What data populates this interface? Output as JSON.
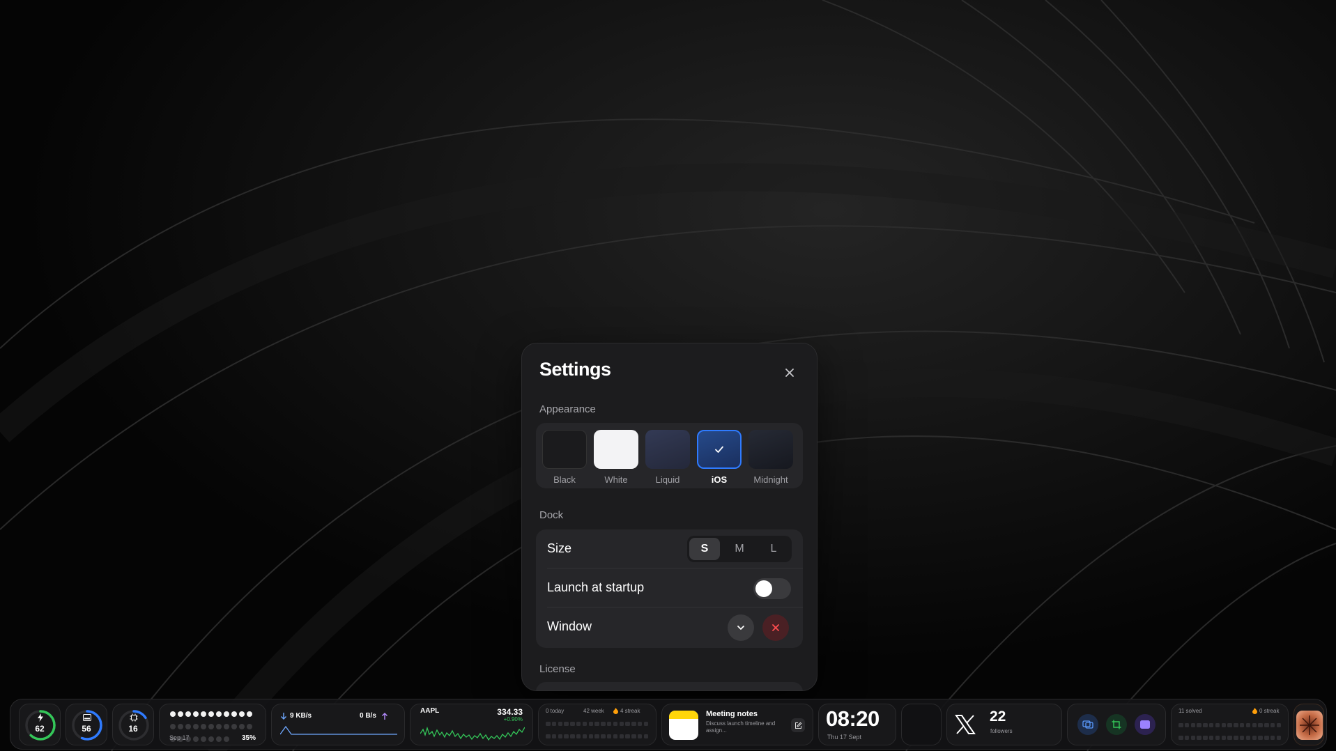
{
  "settings": {
    "title": "Settings",
    "appearance_label": "Appearance",
    "themes": [
      {
        "name": "Black",
        "color": "#1b1b1d",
        "selected": false
      },
      {
        "name": "White",
        "color": "#f3f3f5",
        "selected": false
      },
      {
        "name": "Liquid",
        "color": "#2b2f45",
        "selected": false
      },
      {
        "name": "iOS",
        "color": "#1f3a6e",
        "selected": true
      },
      {
        "name": "Midnight",
        "color": "#1d2029",
        "selected": false
      }
    ],
    "dock_label": "Dock",
    "size_label": "Size",
    "size_options": [
      "S",
      "M",
      "L"
    ],
    "size_selected": "S",
    "launch_label": "Launch at startup",
    "launch_enabled": false,
    "window_label": "Window",
    "license_label": "License"
  },
  "dock": {
    "battery_ring": {
      "value": "62",
      "percent": 62,
      "color": "#34c759"
    },
    "storage_ring": {
      "value": "56",
      "percent": 56,
      "color": "#2f7bff"
    },
    "cpu_ring": {
      "value": "16",
      "percent": 16,
      "color": "#2f7bff"
    },
    "calendar": {
      "date": "Sep 17",
      "percent": "35%",
      "filled_dots": 11,
      "total_dots": 30
    },
    "network": {
      "down": "9 KB/s",
      "up": "0 B/s"
    },
    "stock": {
      "symbol": "AAPL",
      "price": "334.33",
      "change": "+0.90%"
    },
    "habits": {
      "today": "0 today",
      "week": "42 week",
      "streak": "4 streak"
    },
    "notes": {
      "title": "Meeting notes",
      "preview": "Discuss launch timeline and assign..."
    },
    "clock": {
      "time": "08:20",
      "date": "Thu 17 Sept"
    },
    "social": {
      "count": "22",
      "label": "followers"
    },
    "challenge": {
      "solved": "11 solved",
      "streak": "0 streak"
    }
  }
}
